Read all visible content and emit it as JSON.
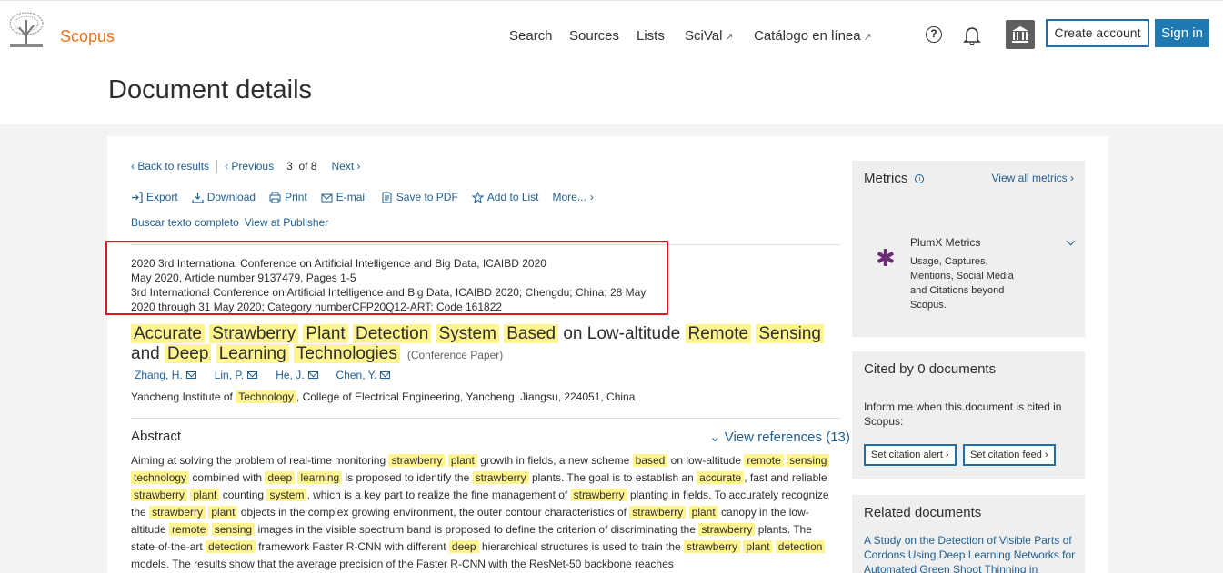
{
  "header": {
    "brand": "Scopus",
    "nav": [
      "Search",
      "Sources",
      "Lists",
      "SciVal",
      "Catálogo en línea"
    ],
    "nav_ext_mark": "↗",
    "help": "?",
    "create_account": "Create account",
    "sign_in": "Sign in",
    "colors": {
      "brand": "#e9711c",
      "accent": "#1f7ab3"
    }
  },
  "page_title": "Document details",
  "result_nav": {
    "back": "Back to results",
    "previous": "Previous",
    "current": "3",
    "of_word": "of",
    "total": "8",
    "next": "Next"
  },
  "tools": [
    "Export",
    "Download",
    "Print",
    "E-mail",
    "Save to PDF",
    "Add to List",
    "More..."
  ],
  "full_text": {
    "buscar": "Buscar texto completo",
    "publisher": "View at Publisher"
  },
  "source": {
    "line1": "2020 3rd International Conference on Artificial Intelligence and Big Data, ICAIBD 2020",
    "line2": "May 2020, Article number 9137479, Pages 1-5",
    "line3": "3rd International Conference on Artificial Intelligence and Big Data, ICAIBD 2020; Chengdu; China; 28 May 2020 through 31 May 2020; Category numberCFP20Q12-ART; Code 161822"
  },
  "document": {
    "title_words": [
      {
        "t": "Accurate",
        "hl": true
      },
      {
        "t": "Strawberry",
        "hl": true
      },
      {
        "t": "Plant",
        "hl": true
      },
      {
        "t": "Detection",
        "hl": true
      },
      {
        "t": "System",
        "hl": true
      },
      {
        "t": "Based",
        "hl": true
      },
      {
        "t": "on Low-altitude",
        "hl": false
      },
      {
        "t": "Remote",
        "hl": true
      },
      {
        "t": "Sensing",
        "hl": true
      },
      {
        "t": "and",
        "hl": false
      },
      {
        "t": "Deep",
        "hl": true
      },
      {
        "t": "Learning",
        "hl": true
      },
      {
        "t": "Technologies",
        "hl": true
      }
    ],
    "type": "(Conference Paper)",
    "authors": [
      "Zhang, H.",
      "Lin, P.",
      "He, J.",
      "Chen, Y."
    ],
    "affiliation": [
      {
        "t": "Yancheng Institute of ",
        "hl": false
      },
      {
        "t": "Technology",
        "hl": true
      },
      {
        "t": ", College of Electrical Engineering, Yancheng, Jiangsu, 224051, China",
        "hl": false
      }
    ]
  },
  "abstract": {
    "heading": "Abstract",
    "view_refs": "View references (13)",
    "segments": [
      {
        "t": "Aiming at solving the problem of real-time monitoring ",
        "hl": false
      },
      {
        "t": "strawberry",
        "hl": true
      },
      {
        "t": " ",
        "hl": false
      },
      {
        "t": "plant",
        "hl": true
      },
      {
        "t": " growth in fields, a new scheme ",
        "hl": false
      },
      {
        "t": "based",
        "hl": true
      },
      {
        "t": " on low-altitude ",
        "hl": false
      },
      {
        "t": "remote",
        "hl": true
      },
      {
        "t": " ",
        "hl": false
      },
      {
        "t": "sensing",
        "hl": true
      },
      {
        "t": " ",
        "hl": false
      },
      {
        "t": "technology",
        "hl": true
      },
      {
        "t": " combined with ",
        "hl": false
      },
      {
        "t": "deep",
        "hl": true
      },
      {
        "t": " ",
        "hl": false
      },
      {
        "t": "learning",
        "hl": true
      },
      {
        "t": " is proposed to identify the ",
        "hl": false
      },
      {
        "t": "strawberry",
        "hl": true
      },
      {
        "t": " plants. The goal is to establish an ",
        "hl": false
      },
      {
        "t": "accurate",
        "hl": true
      },
      {
        "t": ", fast and reliable ",
        "hl": false
      },
      {
        "t": "strawberry",
        "hl": true
      },
      {
        "t": " ",
        "hl": false
      },
      {
        "t": "plant",
        "hl": true
      },
      {
        "t": " counting ",
        "hl": false
      },
      {
        "t": "system",
        "hl": true
      },
      {
        "t": ", which is a key part to realize the fine management of ",
        "hl": false
      },
      {
        "t": "strawberry",
        "hl": true
      },
      {
        "t": " planting in fields. To accurately recognize the ",
        "hl": false
      },
      {
        "t": "strawberry",
        "hl": true
      },
      {
        "t": " ",
        "hl": false
      },
      {
        "t": "plant",
        "hl": true
      },
      {
        "t": " objects in the complex growing environment, the outer contour characteristics of ",
        "hl": false
      },
      {
        "t": "strawberry",
        "hl": true
      },
      {
        "t": " ",
        "hl": false
      },
      {
        "t": "plant",
        "hl": true
      },
      {
        "t": " canopy in the low-altitude ",
        "hl": false
      },
      {
        "t": "remote",
        "hl": true
      },
      {
        "t": " ",
        "hl": false
      },
      {
        "t": "sensing",
        "hl": true
      },
      {
        "t": " images in the visible spectrum band is proposed to define the criterion of discriminating the ",
        "hl": false
      },
      {
        "t": "strawberry",
        "hl": true
      },
      {
        "t": " plants. The state-of-the-art ",
        "hl": false
      },
      {
        "t": "detection",
        "hl": true
      },
      {
        "t": " framework Faster R-CNN with different ",
        "hl": false
      },
      {
        "t": "deep",
        "hl": true
      },
      {
        "t": " hierarchical structures is used to train the ",
        "hl": false
      },
      {
        "t": "strawberry",
        "hl": true
      },
      {
        "t": " ",
        "hl": false
      },
      {
        "t": "plant",
        "hl": true
      },
      {
        "t": " ",
        "hl": false
      },
      {
        "t": "detection",
        "hl": true
      },
      {
        "t": " models. The results show that the average precision of the Faster R-CNN with the ResNet-50 backbone reaches",
        "hl": false
      }
    ]
  },
  "metrics": {
    "title": "Metrics",
    "view_all": "View all metrics",
    "plumx_title": "PlumX Metrics",
    "plumx_desc": "Usage, Captures, Mentions, Social Media and Citations beyond Scopus."
  },
  "cited": {
    "title": "Cited by 0 documents",
    "text": "Inform me when this document is cited in Scopus:",
    "alert": "Set citation alert",
    "feed": "Set citation feed"
  },
  "related": {
    "title": "Related documents",
    "first": "A Study on the Detection of Visible Parts of Cordons Using Deep Learning Networks for Automated Green Shoot Thinning in"
  }
}
